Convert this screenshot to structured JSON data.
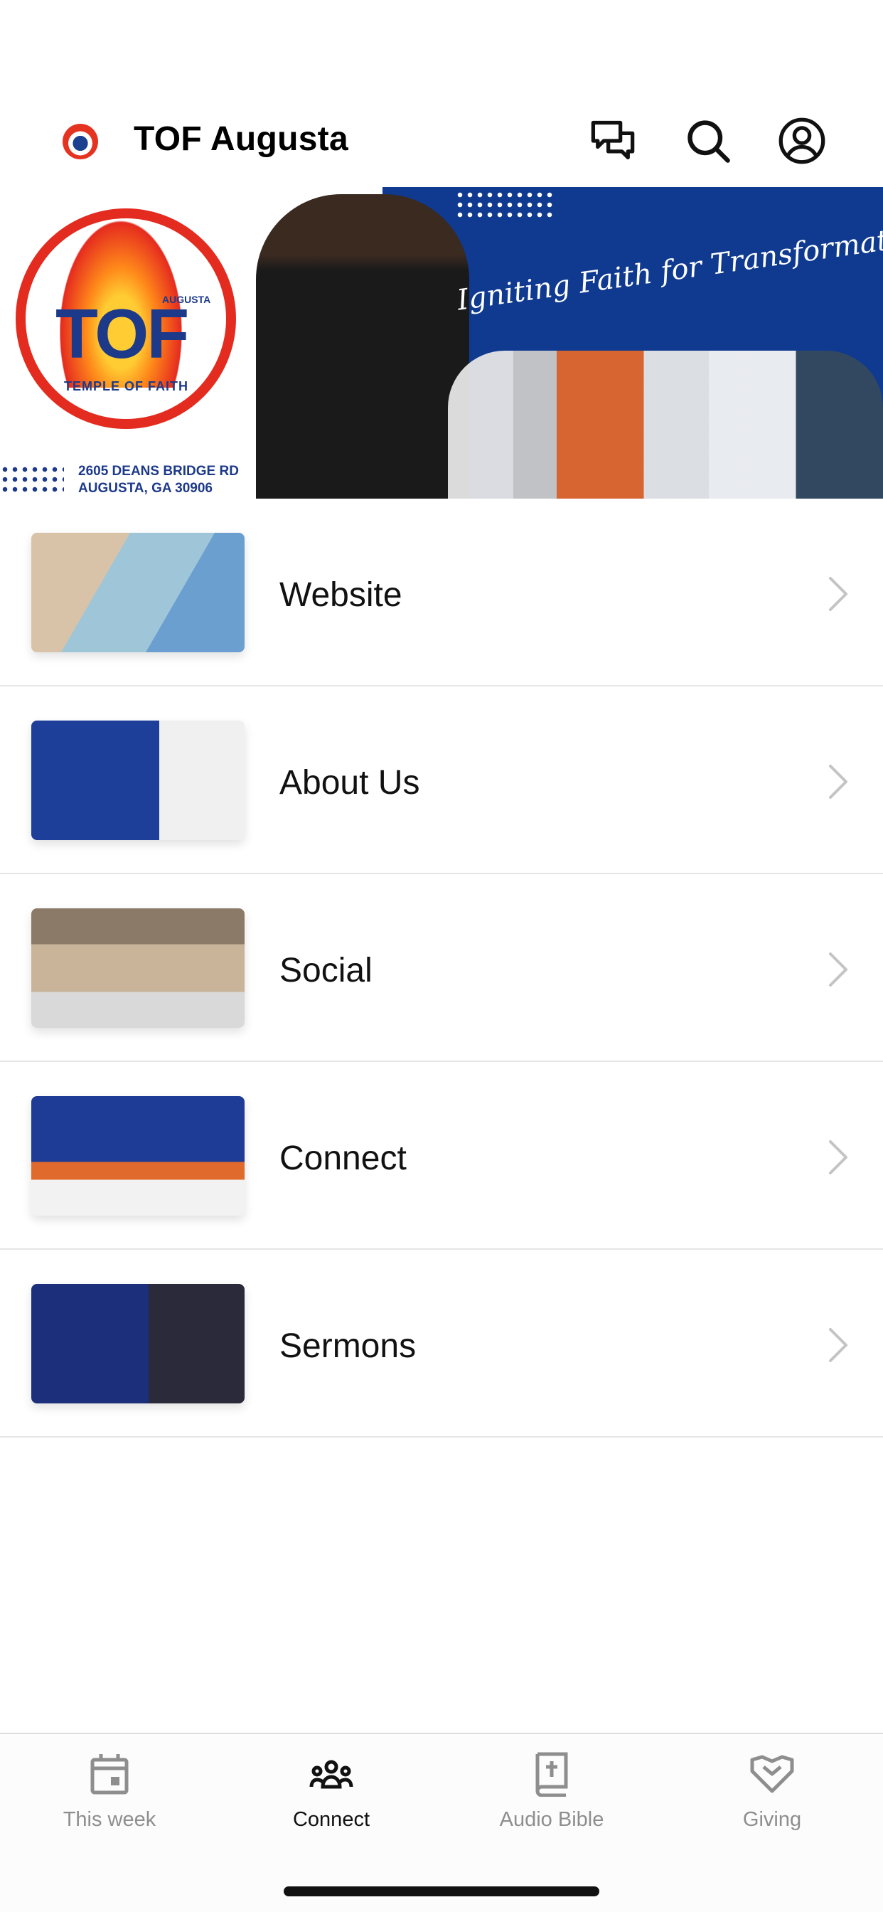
{
  "header": {
    "title": "TOF Augusta",
    "icons": [
      "chat-icon",
      "search-icon",
      "profile-icon"
    ]
  },
  "banner": {
    "logo_main": "TOF",
    "logo_augusta": "AUGUSTA",
    "logo_sub": "TEMPLE OF FAITH",
    "address_line1": "2605 DEANS BRIDGE RD",
    "address_line2": "AUGUSTA, GA 30906",
    "slogan": "Igniting Faith for Transformation"
  },
  "list": {
    "items": [
      {
        "label": "Website"
      },
      {
        "label": "About Us"
      },
      {
        "label": "Social"
      },
      {
        "label": "Connect"
      },
      {
        "label": "Sermons"
      }
    ]
  },
  "tabbar": {
    "tabs": [
      {
        "label": "This week",
        "icon": "calendar-icon",
        "active": false
      },
      {
        "label": "Connect",
        "icon": "group-icon",
        "active": true
      },
      {
        "label": "Audio Bible",
        "icon": "bible-icon",
        "active": false
      },
      {
        "label": "Giving",
        "icon": "handshake-icon",
        "active": false
      }
    ]
  },
  "colors": {
    "brand_blue": "#1d3a8a",
    "brand_red": "#e32b1f",
    "inactive_tab": "#8e8e8e"
  }
}
